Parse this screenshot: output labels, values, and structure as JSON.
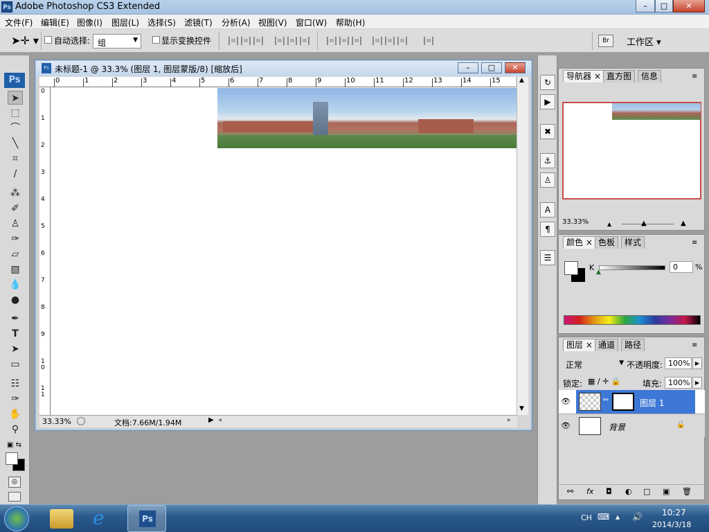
{
  "window": {
    "title": "Adobe Photoshop CS3 Extended",
    "app_icon": "Ps"
  },
  "menu": [
    "文件(F)",
    "编辑(E)",
    "图像(I)",
    "图层(L)",
    "选择(S)",
    "滤镜(T)",
    "分析(A)",
    "视图(V)",
    "窗口(W)",
    "帮助(H)"
  ],
  "options": {
    "auto_select_label": "自动选择:",
    "auto_select_value": "组",
    "show_transform_label": "显示变换控件",
    "workspace_label": "工作区"
  },
  "toolbox": {
    "logo": "Ps"
  },
  "document": {
    "title": "未标题-1 @ 33.3% (图层 1, 图层蒙版/8) [缩放后]",
    "ruler_top": [
      "0",
      "1",
      "2",
      "3",
      "4",
      "5",
      "6",
      "7",
      "8",
      "9",
      "10",
      "11",
      "12",
      "13",
      "14",
      "15"
    ],
    "ruler_left": [
      "0",
      "1",
      "2",
      "3",
      "4",
      "5",
      "6",
      "7",
      "8",
      "9",
      "1 0",
      "1 1"
    ],
    "zoom": "33.33%",
    "doc_size": "文档:7.66M/1.94M"
  },
  "dock_icons": [
    "history-icon",
    "actions-icon",
    "tool-presets-icon",
    "brushes-icon",
    "clone-source-icon",
    "character-icon",
    "paragraph-icon",
    "notes-icon"
  ],
  "navigator": {
    "tabs": [
      "导航器",
      "直方图",
      "信息"
    ],
    "zoom": "33.33%"
  },
  "color": {
    "tabs": [
      "颜色",
      "色板",
      "样式"
    ],
    "channel_label": "K",
    "value": "0",
    "unit": "%"
  },
  "layers": {
    "tabs": [
      "图层",
      "通道",
      "路径"
    ],
    "blend_mode": "正常",
    "opacity_label": "不透明度:",
    "opacity": "100%",
    "lock_label": "锁定:",
    "fill_label": "填充:",
    "fill": "100%",
    "items": [
      {
        "name": "图层 1",
        "selected": true
      },
      {
        "name": "背景",
        "selected": false
      }
    ]
  },
  "taskbar": {
    "lang": "CH",
    "time": "10:27",
    "date": "2014/3/18",
    "ps_label": "Ps"
  }
}
